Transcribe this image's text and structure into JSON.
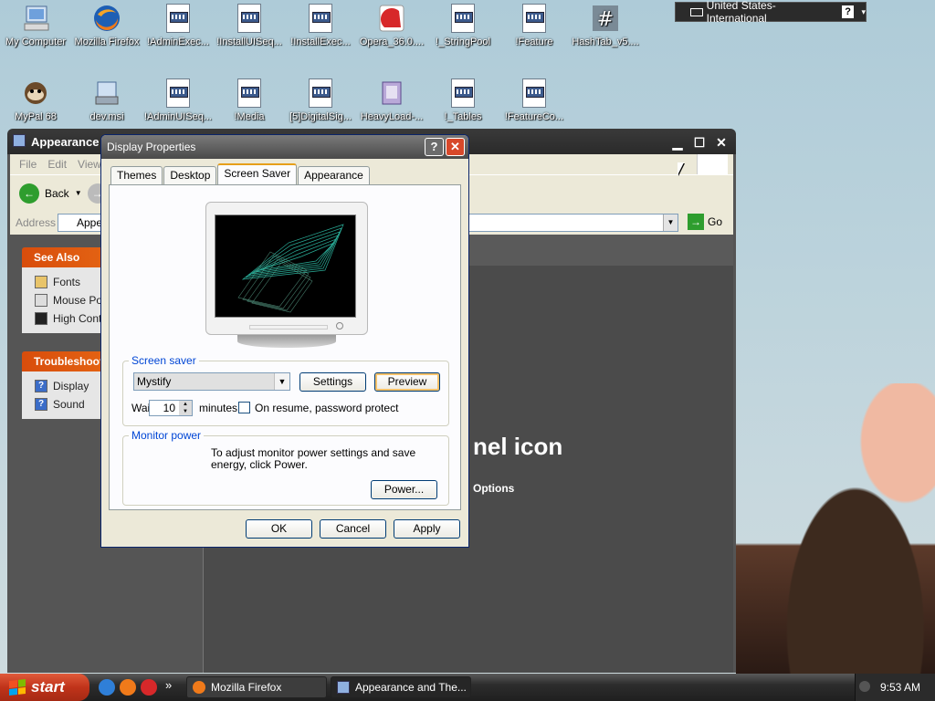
{
  "desktop": {
    "icons_row1": [
      {
        "label": "My Computer",
        "icon": "computer-icon"
      },
      {
        "label": "Mozilla Firefox",
        "icon": "firefox-icon"
      },
      {
        "label": "!AdminExec...",
        "icon": "document-icon"
      },
      {
        "label": "!InstallUISeq...",
        "icon": "document-icon"
      },
      {
        "label": "!InstallExec...",
        "icon": "document-icon"
      },
      {
        "label": "Opera_36.0....",
        "icon": "opera-installer-icon"
      },
      {
        "label": "!_StringPool",
        "icon": "document-icon"
      },
      {
        "label": "!Feature",
        "icon": "document-icon"
      },
      {
        "label": "HashTab_v5....",
        "icon": "hashtab-icon"
      }
    ],
    "icons_row2": [
      {
        "label": "MyPal 68",
        "icon": "mypal-icon"
      },
      {
        "label": "dev.msi",
        "icon": "msi-icon"
      },
      {
        "label": "!AdminUISeq...",
        "icon": "document-icon"
      },
      {
        "label": "!Media",
        "icon": "document-icon"
      },
      {
        "label": "[5]DigitalSig...",
        "icon": "document-icon"
      },
      {
        "label": "HeavyLoad-...",
        "icon": "installer-icon"
      },
      {
        "label": "!_Tables",
        "icon": "document-icon"
      },
      {
        "label": "!FeatureCo...",
        "icon": "document-icon"
      }
    ]
  },
  "language_bar": {
    "label": "United States-International",
    "help": "?"
  },
  "explorer": {
    "title": "Appearance a",
    "menu": [
      "File",
      "Edit",
      "View"
    ],
    "back_label": "Back",
    "address_label": "Address",
    "address_value": "Appea",
    "go_label": "Go",
    "see_also": {
      "header": "See Also",
      "items": [
        "Fonts",
        "Mouse Poi",
        "High Contr"
      ]
    },
    "troubleshoot": {
      "header": "Troubleshoot",
      "items": [
        "Display",
        "Sound"
      ]
    },
    "heading_fragment": "nel icon",
    "subheading_fragment": "Options"
  },
  "dialog": {
    "title": "Display Properties",
    "help_btn": "?",
    "close_btn": "✕",
    "tabs": [
      "Themes",
      "Desktop",
      "Screen Saver",
      "Appearance"
    ],
    "active_tab": "Screen Saver",
    "screen_saver": {
      "group_label": "Screen saver",
      "selected": "Mystify",
      "settings_btn": "Settings",
      "preview_btn": "Preview",
      "wait_label": "Wait:",
      "wait_value": "10",
      "minutes_label": "minutes",
      "resume_label": "On resume, password protect",
      "resume_checked": false
    },
    "monitor_power": {
      "group_label": "Monitor power",
      "text": "To adjust monitor power settings and save energy, click Power.",
      "power_btn": "Power..."
    },
    "ok_btn": "OK",
    "cancel_btn": "Cancel",
    "apply_btn": "Apply"
  },
  "taskbar": {
    "start_label": "start",
    "overflow": "»",
    "items": [
      {
        "label": "Mozilla Firefox",
        "icon": "firefox-icon"
      },
      {
        "label": "Appearance and The...",
        "icon": "control-panel-icon"
      }
    ],
    "clock": "9:53 AM"
  },
  "colors": {
    "accent_orange": "#e69f1a",
    "group_label_blue": "#0046d5",
    "close_red": "#d7482a",
    "task_header_orange": "#d84d0c",
    "start_red": "#c0331a"
  }
}
